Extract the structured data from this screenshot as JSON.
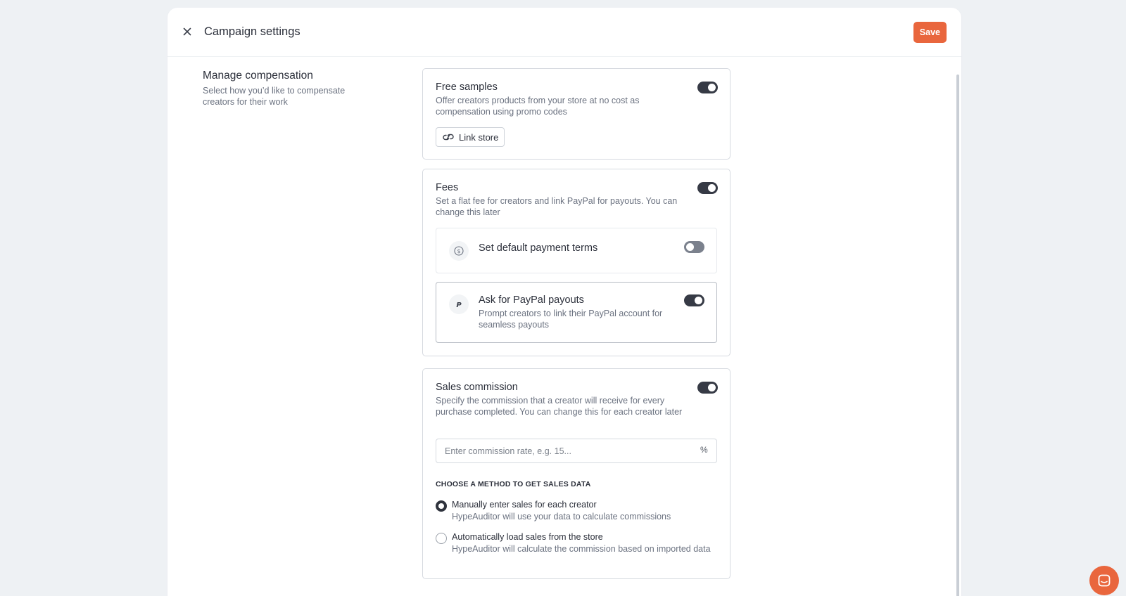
{
  "header": {
    "title": "Campaign settings",
    "save_label": "Save"
  },
  "section": {
    "title": "Manage compensation",
    "description": "Select how you’d like to compensate creators for their work"
  },
  "free_samples": {
    "title": "Free samples",
    "description": "Offer creators products from your store at no cost as compensation using promo codes",
    "enabled": true,
    "link_store_label": "Link store"
  },
  "fees": {
    "title": "Fees",
    "description": "Set a flat fee for creators and link PayPal for payouts. You can change this later",
    "enabled": true,
    "payment_terms": {
      "title": "Set default payment terms",
      "enabled": false,
      "icon": "dollar-circle-icon"
    },
    "paypal": {
      "title": "Ask for PayPal payouts",
      "description": "Prompt creators to link their PayPal account for seamless payouts",
      "enabled": true,
      "icon": "paypal-icon"
    }
  },
  "sales_commission": {
    "title": "Sales commission",
    "description": "Specify the commission that a creator will receive for every purchase completed. You can change this for each creator later",
    "enabled": true,
    "rate_placeholder": "Enter commission rate, e.g. 15...",
    "rate_value": "",
    "percent_symbol": "%",
    "method_heading": "CHOOSE A METHOD TO GET SALES DATA",
    "methods": [
      {
        "label": "Manually enter sales for each creator",
        "description": "HypeAuditor will use your data to calculate commissions",
        "selected": true
      },
      {
        "label": "Automatically load sales from the store",
        "description": "HypeAuditor will calculate the commission based on imported data",
        "selected": false
      }
    ]
  },
  "colors": {
    "accent": "#e9663d",
    "toggle_on": "#363a45",
    "toggle_off": "#7b818d",
    "background": "#eef1f4"
  }
}
